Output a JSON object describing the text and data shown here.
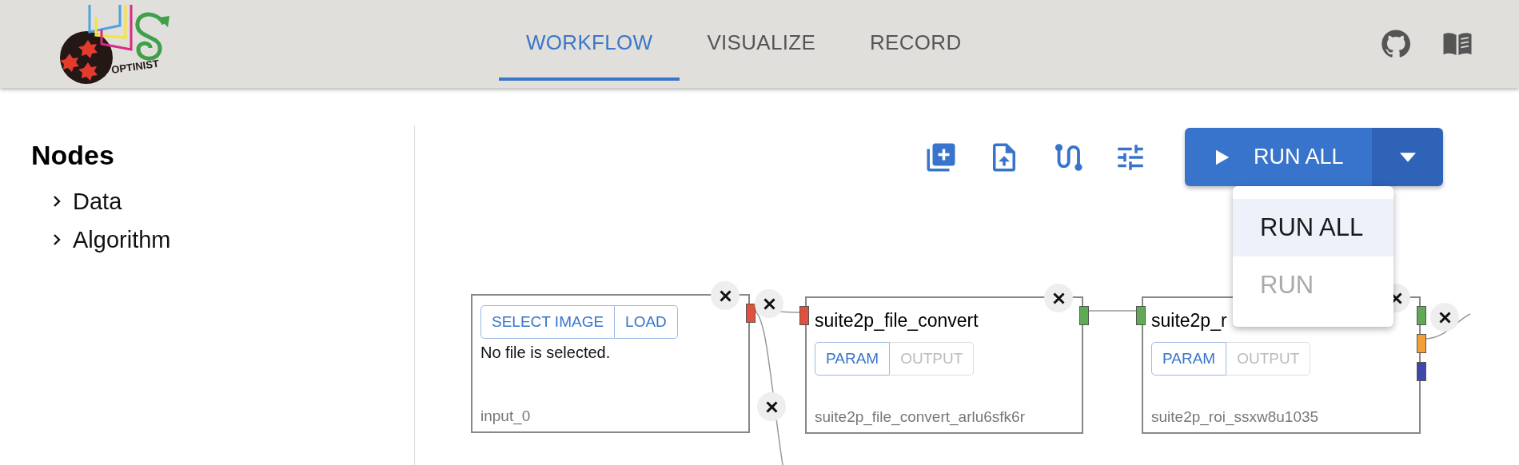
{
  "header": {
    "logo_text": "OPTINIST",
    "tabs": [
      {
        "label": "WORKFLOW",
        "selected": true
      },
      {
        "label": "VISUALIZE",
        "selected": false
      },
      {
        "label": "RECORD",
        "selected": false
      }
    ]
  },
  "sidebar": {
    "title": "Nodes",
    "items": [
      {
        "label": "Data",
        "expanded": false
      },
      {
        "label": "Algorithm",
        "expanded": false
      }
    ]
  },
  "toolbar": {
    "run_button": {
      "label": "RUN ALL"
    },
    "menu": [
      {
        "label": "RUN ALL",
        "selected": true,
        "disabled": false
      },
      {
        "label": "RUN",
        "selected": false,
        "disabled": true
      }
    ]
  },
  "nodes": [
    {
      "kind": "input",
      "buttons": [
        {
          "label": "SELECT IMAGE",
          "disabled": false
        },
        {
          "label": "LOAD",
          "disabled": false
        }
      ],
      "message": "No file is selected.",
      "footer": "input_0",
      "outputs": [
        {
          "color": "#e0503e"
        }
      ]
    },
    {
      "kind": "algorithm",
      "title": "suite2p_file_convert",
      "buttons": [
        {
          "label": "PARAM",
          "disabled": false
        },
        {
          "label": "OUTPUT",
          "disabled": true
        }
      ],
      "footer": "suite2p_file_convert_arlu6sfk6r",
      "inputs": [
        {
          "color": "#e0503e"
        }
      ],
      "outputs": [
        {
          "color": "#5fab55"
        }
      ]
    },
    {
      "kind": "algorithm",
      "title": "suite2p_r",
      "buttons": [
        {
          "label": "PARAM",
          "disabled": false
        },
        {
          "label": "OUTPUT",
          "disabled": true
        }
      ],
      "footer": "suite2p_roi_ssxw8u1035",
      "inputs": [
        {
          "color": "#5fab55"
        }
      ],
      "outputs": [
        {
          "color": "#5fab55"
        },
        {
          "color": "#f0a035"
        },
        {
          "color": "#3f48a8"
        }
      ]
    }
  ]
}
